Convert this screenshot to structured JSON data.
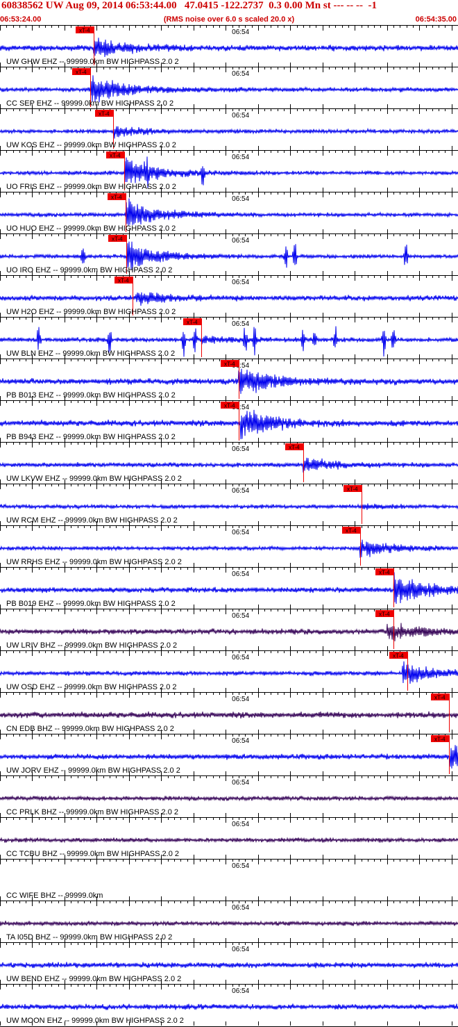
{
  "header": {
    "title": "60838562 UW Aug 09, 2014 06:53:44.00   47.0415 -122.2737  0.3 0.00 Mn st --- -- --  -1",
    "start_time": "06:53:24.00",
    "noise_note": "(RMS noise over 6.0 s scaled 20.0 x)",
    "end_time": "06:54:35.00"
  },
  "colors": {
    "header_red": "#cc0000",
    "trace_blue": "#0000ee",
    "trace_purple": "#330055",
    "pick_red": "#ee0000",
    "grid": "#000000"
  },
  "chart_data": {
    "type": "line",
    "time_axis": {
      "start": "06:53:24.00",
      "end": "06:54:35.00",
      "minute_label": "06:54",
      "minute_seconds": 36
    },
    "pick_label": "xT-4",
    "traces": [
      {
        "label": "UW GHW EHZ -- 99999.0km BW  HIGHPASS  2.0  2",
        "color": "blue",
        "pick_s": 14.5,
        "burst_s": 14.5,
        "burst_amp": 0.6,
        "noise": 0.13,
        "spikes": []
      },
      {
        "label": "CC SEP EHZ -- 99999.0km BW  HIGHPASS  2.0  2",
        "color": "blue",
        "pick_s": 14.0,
        "burst_s": 14.0,
        "burst_amp": 1.0,
        "noise": 0.1,
        "spikes": []
      },
      {
        "label": "UW KOS EHZ -- 99999.0km BW  HIGHPASS  2.0  2",
        "color": "blue",
        "pick_s": 17.5,
        "burst_s": 17.5,
        "burst_amp": 0.35,
        "noise": 0.09,
        "spikes": []
      },
      {
        "label": "UO FRIS EHZ -- 99999.0km BW  HIGHPASS  2.0  2",
        "color": "blue",
        "pick_s": 19.3,
        "burst_s": 19.3,
        "burst_amp": 1.0,
        "noise": 0.09,
        "spikes": [
          22.7,
          31.5
        ]
      },
      {
        "label": "UO HUO EHZ -- 99999.0km BW  HIGHPASS  2.0  2",
        "color": "blue",
        "pick_s": 19.5,
        "burst_s": 19.5,
        "burst_amp": 1.0,
        "noise": 0.09,
        "spikes": []
      },
      {
        "label": "UO IRO EHZ -- 99999.0km BW  HIGHPASS  2.0  2",
        "color": "blue",
        "pick_s": 19.6,
        "burst_s": 19.6,
        "burst_amp": 1.0,
        "noise": 0.09,
        "spikes": [
          12.9,
          44.3,
          45.7,
          62.9
        ]
      },
      {
        "label": "UW H2O EHZ -- 99999.0km BW  HIGHPASS  2.0  2",
        "color": "blue",
        "pick_s": 20.5,
        "burst_s": 21.0,
        "burst_amp": 0.45,
        "noise": 0.12,
        "spikes": []
      },
      {
        "label": "UW BLN EHZ -- 99999.0km BW  HIGHPASS  2.0  2",
        "color": "blue",
        "pick_s": 31.2,
        "burst_s": 31.2,
        "burst_amp": 0.2,
        "noise": 0.1,
        "spikes": [
          6.0,
          17.0,
          28.5,
          30.2,
          38.0,
          39.5,
          47.0,
          48.8,
          52.0,
          59.5,
          61.0
        ]
      },
      {
        "label": "PB B013 EHZ -- 99999.0km BW  HIGHPASS  2.0  2",
        "color": "blue",
        "pick_s": 37.0,
        "burst_s": 37.0,
        "burst_amp": 1.0,
        "noise": 0.14,
        "spikes": []
      },
      {
        "label": "PB B943 EHZ -- 99999.0km BW  HIGHPASS  2.0  2",
        "color": "blue",
        "pick_s": 37.0,
        "burst_s": 37.3,
        "burst_amp": 1.0,
        "noise": 0.14,
        "spikes": []
      },
      {
        "label": "UW LKVW EHZ -- 99999.0km BW  HIGHPASS  2.0  2",
        "color": "blue",
        "pick_s": 47.0,
        "burst_s": 47.0,
        "burst_amp": 0.45,
        "noise": 0.1,
        "spikes": []
      },
      {
        "label": "UW RCM EHZ -- 99999.0km BW  HIGHPASS  2.0  2",
        "color": "blue",
        "pick_s": 56.1,
        "burst_s": 56.1,
        "burst_amp": 0.12,
        "noise": 0.09,
        "spikes": []
      },
      {
        "label": "UW RRHS EHZ -- 99999.0km BW  HIGHPASS  2.0  2",
        "color": "blue",
        "pick_s": 55.8,
        "burst_s": 55.8,
        "burst_amp": 0.6,
        "noise": 0.09,
        "spikes": []
      },
      {
        "label": "PB B019 EHZ -- 99999.0km BW  HIGHPASS  2.0  2",
        "color": "blue",
        "pick_s": 61.0,
        "burst_s": 61.0,
        "burst_amp": 1.0,
        "noise": 0.12,
        "spikes": []
      },
      {
        "label": "UW LRIV BHZ -- 99999.0km BW  HIGHPASS  2.0  2",
        "color": "purple",
        "pick_s": 61.0,
        "burst_s": 60.0,
        "burst_amp": 0.6,
        "noise": 0.12,
        "spikes": []
      },
      {
        "label": "UW OSD EHZ -- 99999.0km BW  HIGHPASS  2.0  2",
        "color": "blue",
        "pick_s": 63.1,
        "burst_s": 62.3,
        "burst_amp": 0.7,
        "noise": 0.1,
        "spikes": []
      },
      {
        "label": "CN EDB BHZ -- 99999.0km BW  HIGHPASS  2.0  2",
        "color": "purple",
        "pick_s": 69.6,
        "burst_s": null,
        "burst_amp": 0,
        "noise": 0.14,
        "spikes": []
      },
      {
        "label": "UW JORV EHZ -- 99999.0km BW  HIGHPASS  2.0  2",
        "color": "blue",
        "pick_s": 69.6,
        "burst_s": 69.8,
        "burst_amp": 0.8,
        "noise": 0.12,
        "spikes": []
      },
      {
        "label": "CC PRLK BHZ -- 99999.0km BW  HIGHPASS  2.0  2",
        "color": "purple",
        "pick_s": null,
        "burst_s": null,
        "burst_amp": 0,
        "noise": 0.1,
        "spikes": []
      },
      {
        "label": "CC TCBU BHZ -- 99999.0km BW  HIGHPASS  2.0  2",
        "color": "purple",
        "pick_s": null,
        "burst_s": null,
        "burst_amp": 0,
        "noise": 0.1,
        "spikes": []
      },
      {
        "label": "CC WIFE BHZ -- 99999.0km",
        "color": "none",
        "pick_s": null,
        "burst_s": null,
        "burst_amp": 0,
        "noise": 0,
        "spikes": []
      },
      {
        "label": "TA I05D BHZ -- 99999.0km BW  HIGHPASS  2.0  2",
        "color": "purple",
        "pick_s": null,
        "burst_s": null,
        "burst_amp": 0,
        "noise": 0.1,
        "spikes": []
      },
      {
        "label": "UW BEND EHZ -- 99999.0km BW  HIGHPASS  2.0  2",
        "color": "blue",
        "pick_s": null,
        "burst_s": null,
        "burst_amp": 0,
        "noise": 0.12,
        "spikes": []
      },
      {
        "label": "UW MOON EHZ -- 99999.0km BW  HIGHPASS  2.0  2",
        "color": "blue",
        "pick_s": null,
        "burst_s": null,
        "burst_amp": 0,
        "noise": 0.12,
        "spikes": []
      }
    ]
  }
}
